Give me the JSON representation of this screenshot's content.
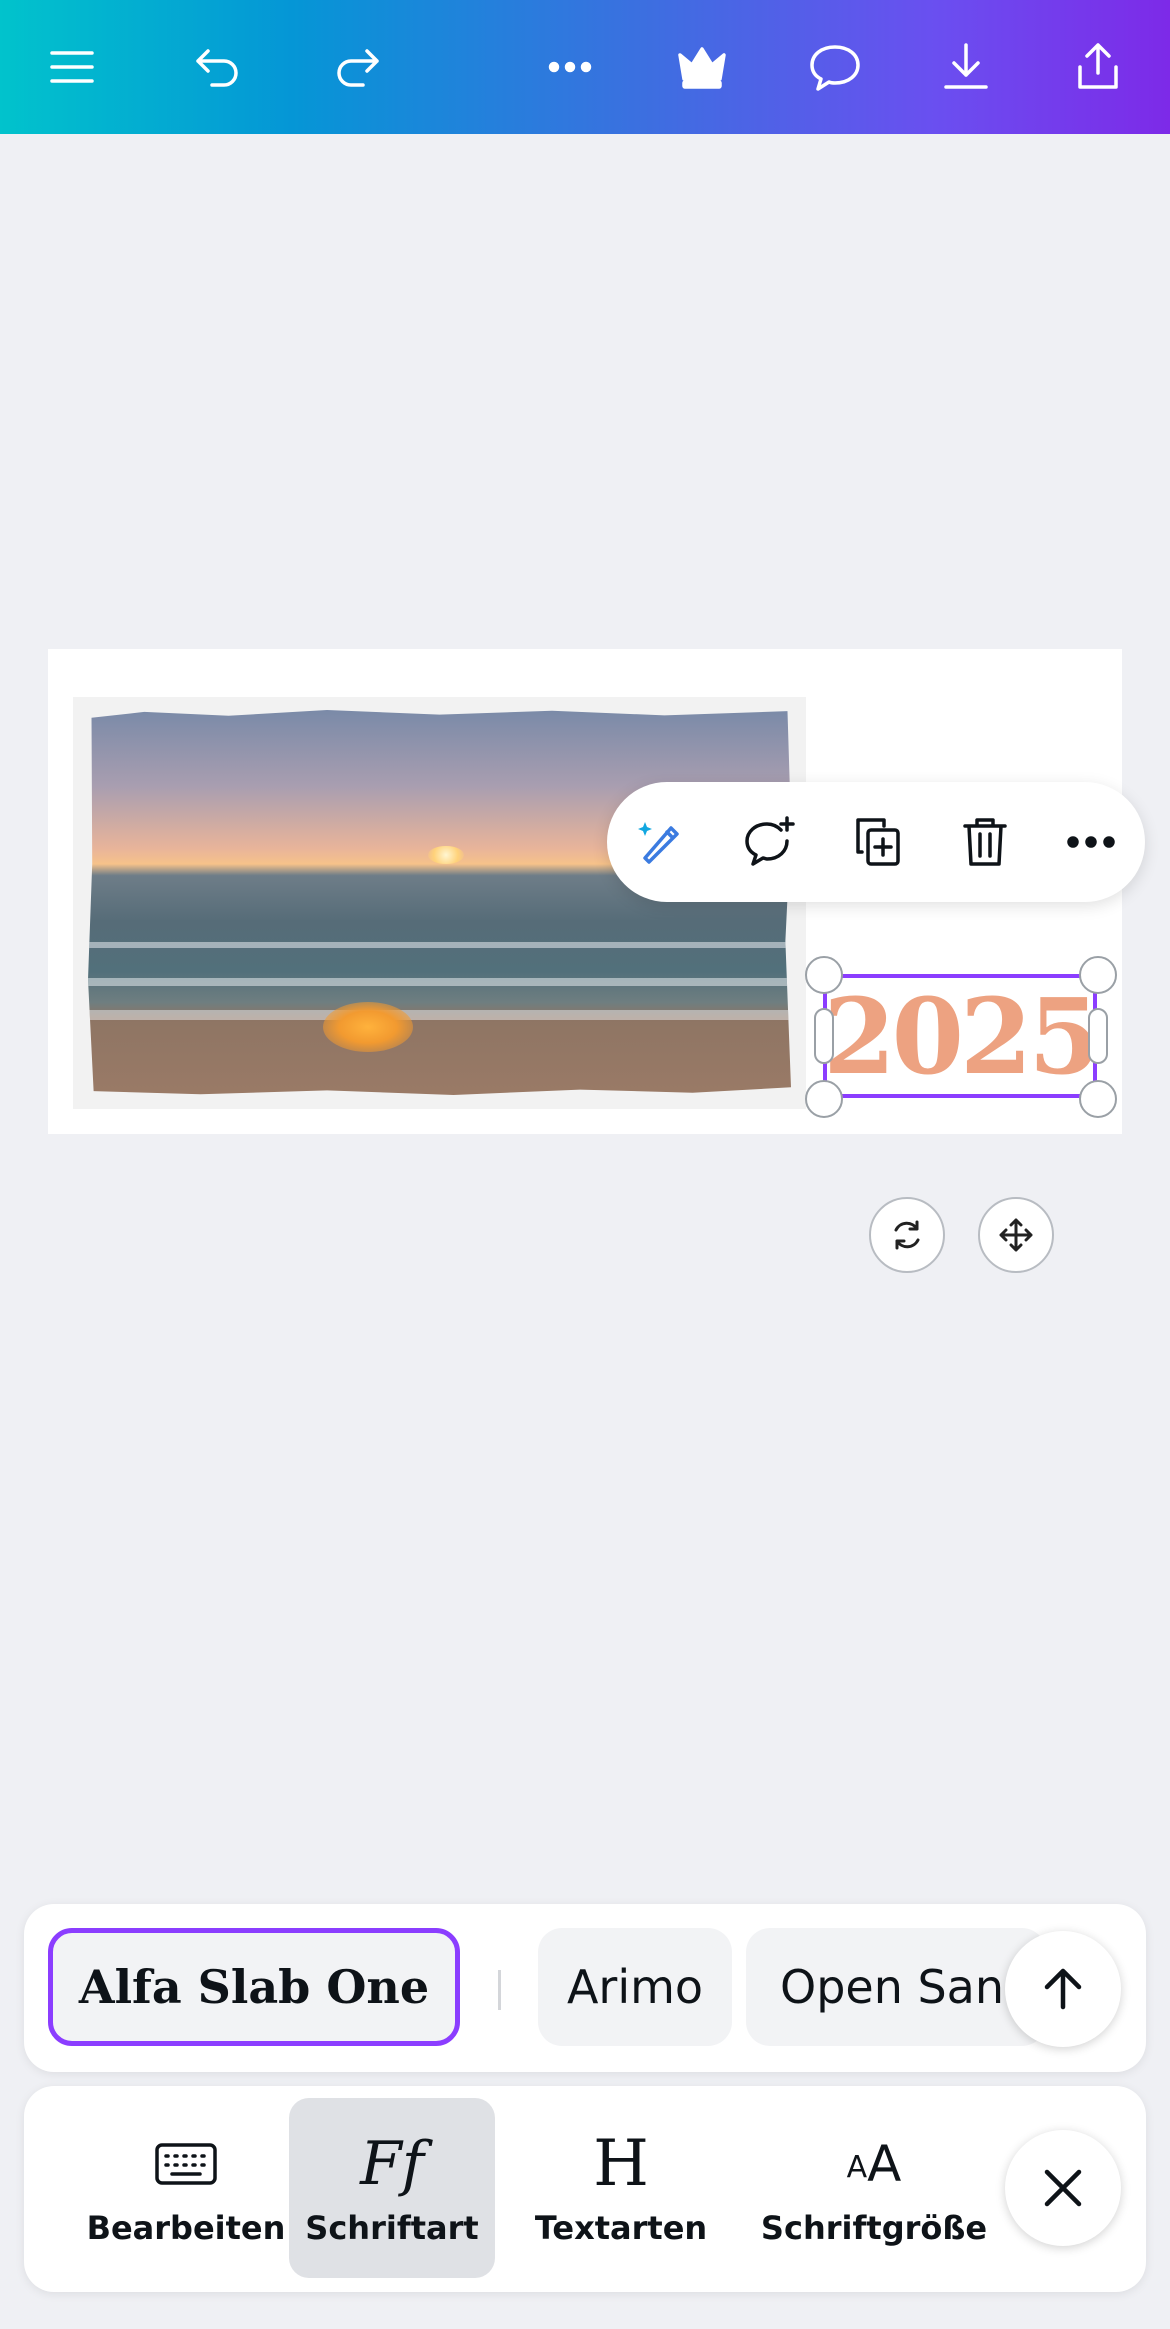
{
  "topbar": {
    "icons": [
      "menu-icon",
      "undo-icon",
      "redo-icon",
      "more-icon",
      "crown-icon",
      "comment-icon",
      "download-icon",
      "share-icon"
    ]
  },
  "canvas": {
    "selected_text": "2025",
    "text_color": "#eda281",
    "selection_color": "#8b3dff",
    "image": "beach-sunset-photo"
  },
  "context_toolbar": {
    "icons": [
      "magic-edit-icon",
      "add-comment-icon",
      "duplicate-icon",
      "delete-icon",
      "more-icon"
    ]
  },
  "canvas_controls": {
    "icons": [
      "rotate-icon",
      "move-icon"
    ]
  },
  "fonts": {
    "selected": "Alfa Slab One",
    "options": [
      "Arimo",
      "Open Sans"
    ]
  },
  "toolbar": {
    "items": [
      {
        "label": "Bearbeiten",
        "icon": "keyboard-icon"
      },
      {
        "label": "Schriftart",
        "icon": "font-icon"
      },
      {
        "label": "Textarten",
        "icon": "heading-icon"
      },
      {
        "label": "Schriftgröße",
        "icon": "font-size-icon"
      }
    ],
    "active": "Schriftart",
    "font_glyph": "Ff",
    "heading_glyph": "H",
    "size_glyph_small": "A",
    "size_glyph_large": "A"
  }
}
